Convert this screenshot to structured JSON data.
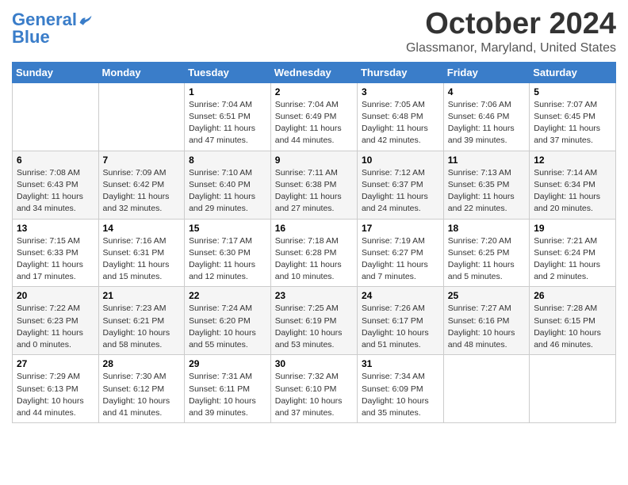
{
  "header": {
    "logo": {
      "line1": "General",
      "line2": "Blue"
    },
    "title": "October 2024",
    "subtitle": "Glassmanor, Maryland, United States"
  },
  "days_of_week": [
    "Sunday",
    "Monday",
    "Tuesday",
    "Wednesday",
    "Thursday",
    "Friday",
    "Saturday"
  ],
  "weeks": [
    {
      "days": [
        {
          "num": "",
          "info": ""
        },
        {
          "num": "",
          "info": ""
        },
        {
          "num": "1",
          "info": "Sunrise: 7:04 AM\nSunset: 6:51 PM\nDaylight: 11 hours and 47 minutes."
        },
        {
          "num": "2",
          "info": "Sunrise: 7:04 AM\nSunset: 6:49 PM\nDaylight: 11 hours and 44 minutes."
        },
        {
          "num": "3",
          "info": "Sunrise: 7:05 AM\nSunset: 6:48 PM\nDaylight: 11 hours and 42 minutes."
        },
        {
          "num": "4",
          "info": "Sunrise: 7:06 AM\nSunset: 6:46 PM\nDaylight: 11 hours and 39 minutes."
        },
        {
          "num": "5",
          "info": "Sunrise: 7:07 AM\nSunset: 6:45 PM\nDaylight: 11 hours and 37 minutes."
        }
      ]
    },
    {
      "days": [
        {
          "num": "6",
          "info": "Sunrise: 7:08 AM\nSunset: 6:43 PM\nDaylight: 11 hours and 34 minutes."
        },
        {
          "num": "7",
          "info": "Sunrise: 7:09 AM\nSunset: 6:42 PM\nDaylight: 11 hours and 32 minutes."
        },
        {
          "num": "8",
          "info": "Sunrise: 7:10 AM\nSunset: 6:40 PM\nDaylight: 11 hours and 29 minutes."
        },
        {
          "num": "9",
          "info": "Sunrise: 7:11 AM\nSunset: 6:38 PM\nDaylight: 11 hours and 27 minutes."
        },
        {
          "num": "10",
          "info": "Sunrise: 7:12 AM\nSunset: 6:37 PM\nDaylight: 11 hours and 24 minutes."
        },
        {
          "num": "11",
          "info": "Sunrise: 7:13 AM\nSunset: 6:35 PM\nDaylight: 11 hours and 22 minutes."
        },
        {
          "num": "12",
          "info": "Sunrise: 7:14 AM\nSunset: 6:34 PM\nDaylight: 11 hours and 20 minutes."
        }
      ]
    },
    {
      "days": [
        {
          "num": "13",
          "info": "Sunrise: 7:15 AM\nSunset: 6:33 PM\nDaylight: 11 hours and 17 minutes."
        },
        {
          "num": "14",
          "info": "Sunrise: 7:16 AM\nSunset: 6:31 PM\nDaylight: 11 hours and 15 minutes."
        },
        {
          "num": "15",
          "info": "Sunrise: 7:17 AM\nSunset: 6:30 PM\nDaylight: 11 hours and 12 minutes."
        },
        {
          "num": "16",
          "info": "Sunrise: 7:18 AM\nSunset: 6:28 PM\nDaylight: 11 hours and 10 minutes."
        },
        {
          "num": "17",
          "info": "Sunrise: 7:19 AM\nSunset: 6:27 PM\nDaylight: 11 hours and 7 minutes."
        },
        {
          "num": "18",
          "info": "Sunrise: 7:20 AM\nSunset: 6:25 PM\nDaylight: 11 hours and 5 minutes."
        },
        {
          "num": "19",
          "info": "Sunrise: 7:21 AM\nSunset: 6:24 PM\nDaylight: 11 hours and 2 minutes."
        }
      ]
    },
    {
      "days": [
        {
          "num": "20",
          "info": "Sunrise: 7:22 AM\nSunset: 6:23 PM\nDaylight: 11 hours and 0 minutes."
        },
        {
          "num": "21",
          "info": "Sunrise: 7:23 AM\nSunset: 6:21 PM\nDaylight: 10 hours and 58 minutes."
        },
        {
          "num": "22",
          "info": "Sunrise: 7:24 AM\nSunset: 6:20 PM\nDaylight: 10 hours and 55 minutes."
        },
        {
          "num": "23",
          "info": "Sunrise: 7:25 AM\nSunset: 6:19 PM\nDaylight: 10 hours and 53 minutes."
        },
        {
          "num": "24",
          "info": "Sunrise: 7:26 AM\nSunset: 6:17 PM\nDaylight: 10 hours and 51 minutes."
        },
        {
          "num": "25",
          "info": "Sunrise: 7:27 AM\nSunset: 6:16 PM\nDaylight: 10 hours and 48 minutes."
        },
        {
          "num": "26",
          "info": "Sunrise: 7:28 AM\nSunset: 6:15 PM\nDaylight: 10 hours and 46 minutes."
        }
      ]
    },
    {
      "days": [
        {
          "num": "27",
          "info": "Sunrise: 7:29 AM\nSunset: 6:13 PM\nDaylight: 10 hours and 44 minutes."
        },
        {
          "num": "28",
          "info": "Sunrise: 7:30 AM\nSunset: 6:12 PM\nDaylight: 10 hours and 41 minutes."
        },
        {
          "num": "29",
          "info": "Sunrise: 7:31 AM\nSunset: 6:11 PM\nDaylight: 10 hours and 39 minutes."
        },
        {
          "num": "30",
          "info": "Sunrise: 7:32 AM\nSunset: 6:10 PM\nDaylight: 10 hours and 37 minutes."
        },
        {
          "num": "31",
          "info": "Sunrise: 7:34 AM\nSunset: 6:09 PM\nDaylight: 10 hours and 35 minutes."
        },
        {
          "num": "",
          "info": ""
        },
        {
          "num": "",
          "info": ""
        }
      ]
    }
  ]
}
